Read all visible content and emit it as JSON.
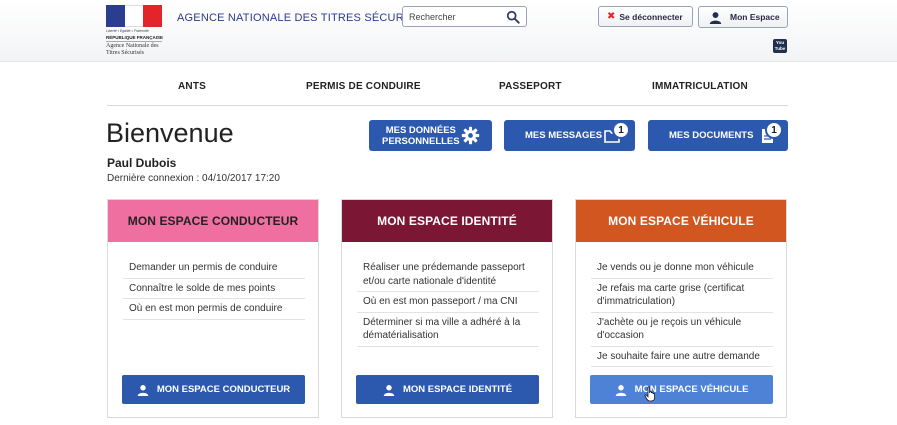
{
  "header": {
    "logo": {
      "motto": "Liberté • Égalité • Fraternité",
      "republic": "RÉPUBLIQUE FRANÇAISE",
      "agency_small": "Agence Nationale des Titres Sécurisés"
    },
    "agency_name": "AGENCE NATIONALE DES TITRES SÉCURISÉS",
    "search": {
      "placeholder": "Rechercher"
    },
    "logout_label": "Se déconnecter",
    "my_space_label": "Mon Espace",
    "youtube_label_1": "You",
    "youtube_label_2": "Tube"
  },
  "nav": {
    "items": [
      {
        "label": "ANTS"
      },
      {
        "label": "PERMIS DE CONDUIRE"
      },
      {
        "label": "PASSEPORT"
      },
      {
        "label": "IMMATRICULATION"
      }
    ]
  },
  "welcome": {
    "title": "Bienvenue",
    "user_name": "Paul Dubois",
    "last_login": "Dernière connexion : 04/10/2017 17:20"
  },
  "actions": {
    "data_line1": "MES DONNÉES",
    "data_line2": "PERSONNELLES",
    "messages_label": "MES MESSAGES",
    "messages_count": "1",
    "documents_label": "MES DOCUMENTS",
    "documents_count": "1"
  },
  "cards": [
    {
      "title": "MON ESPACE CONDUCTEUR",
      "color": "#ef6fa1",
      "title_color": "#222222",
      "links": [
        "Demander un permis de conduire",
        "Connaître le solde de mes points",
        "Où en est mon permis de conduire"
      ],
      "button": "MON ESPACE CONDUCTEUR"
    },
    {
      "title": "MON ESPACE IDENTITÉ",
      "color": "#7b1634",
      "title_color": "#ffffff",
      "links": [
        "Réaliser une prédemande passeport et/ou carte nationale d'identité",
        "Où en est mon passeport / ma CNI",
        "Déterminer si ma ville a adhéré à la dématérialisation"
      ],
      "button": "MON ESPACE IDENTITÉ"
    },
    {
      "title": "MON ESPACE VÉHICULE",
      "color": "#d2561f",
      "title_color": "#ffffff",
      "links": [
        "Je vends ou je donne mon véhicule",
        "Je refais ma carte grise (certificat d'immatriculation)",
        "J'achète ou je reçois un véhicule d'occasion",
        "Je souhaite faire une autre demande"
      ],
      "button": "MON ESPACE VÉHICULE"
    }
  ],
  "colors": {
    "primary_button": "#2c58ad",
    "primary_button_hover": "#4e82d6",
    "flag_blue": "#2a3d8f",
    "flag_red": "#e4242b"
  }
}
